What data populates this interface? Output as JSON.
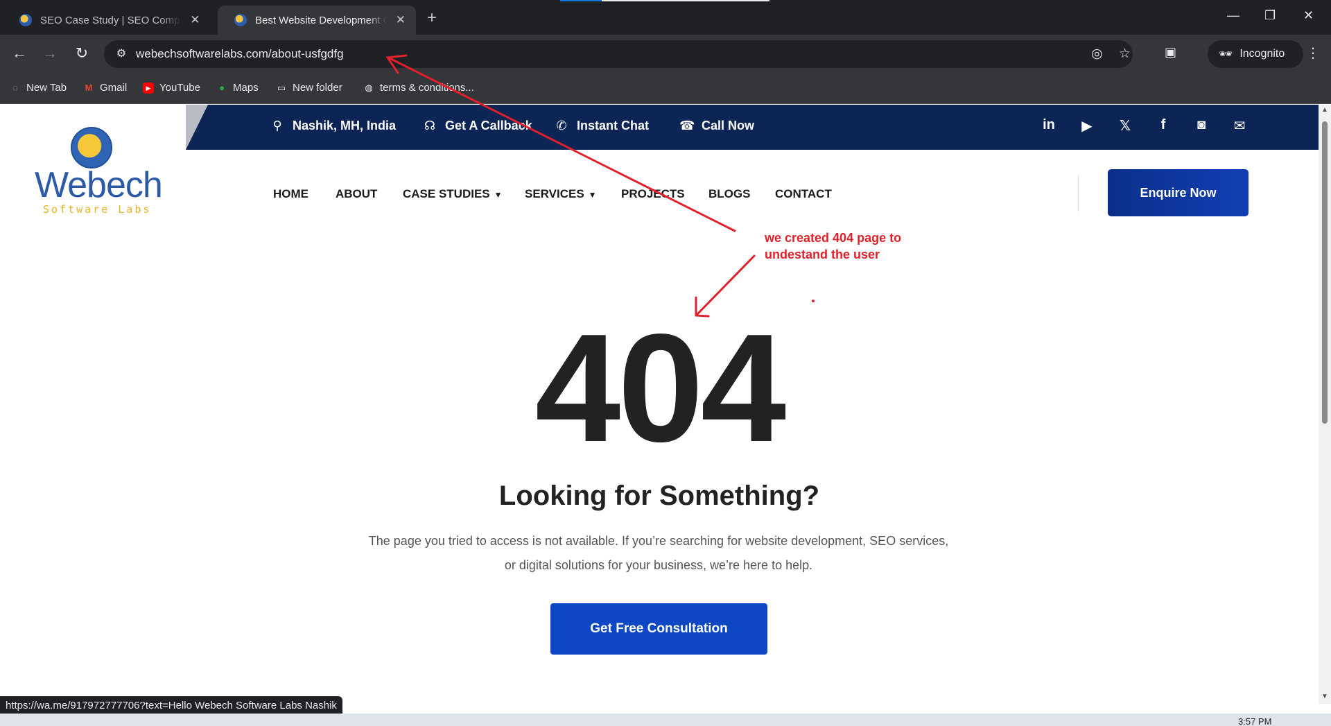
{
  "browser": {
    "tabs": [
      {
        "title": "SEO Case Study | SEO Company",
        "close": "✕",
        "active": false
      },
      {
        "title": "Best Website Development Company",
        "close": "✕",
        "active": true
      }
    ],
    "new_tab": "+",
    "window_controls": {
      "minimize": "—",
      "restore": "❐",
      "close": "✕"
    },
    "url": "webechsoftwarelabs.com/about-usfgdfg",
    "incognito_label": "Incognito",
    "bookmarks": [
      {
        "label": "New Tab",
        "icon": "globe-icon"
      },
      {
        "label": "Gmail",
        "icon": "gmail-icon"
      },
      {
        "label": "YouTube",
        "icon": "youtube-icon"
      },
      {
        "label": "Maps",
        "icon": "maps-icon"
      },
      {
        "label": "New folder",
        "icon": "folder-icon"
      },
      {
        "label": "terms & conditions...",
        "icon": "globe-icon"
      }
    ],
    "status_url": "https://wa.me/917972777706?text=Hello Webech Software Labs Nashik",
    "clock": "3:57 PM"
  },
  "site": {
    "logo": {
      "word": "Webech",
      "sub": "Software Labs"
    },
    "topbar": [
      {
        "label": "Nashik, MH, India",
        "icon": "location-pin-icon"
      },
      {
        "label": "Get A Callback",
        "icon": "headset-icon"
      },
      {
        "label": "Instant Chat",
        "icon": "whatsapp-icon"
      },
      {
        "label": "Call Now",
        "icon": "phone-icon"
      }
    ],
    "social": [
      "linkedin-icon",
      "youtube-icon",
      "x-icon",
      "facebook-icon",
      "instagram-icon",
      "email-icon"
    ],
    "nav": [
      {
        "label": "HOME",
        "dropdown": false
      },
      {
        "label": "ABOUT",
        "dropdown": false
      },
      {
        "label": "CASE STUDIES",
        "dropdown": true
      },
      {
        "label": "SERVICES",
        "dropdown": true
      },
      {
        "label": "PROJECTS",
        "dropdown": false
      },
      {
        "label": "BLOGS",
        "dropdown": false
      },
      {
        "label": "CONTACT",
        "dropdown": false
      }
    ],
    "enquire_label": "Enquire Now",
    "error": {
      "code": "404",
      "heading": "Looking for Something?",
      "description_line1": "The page you tried to access is not available. If you’re searching for website development, SEO services,",
      "description_line2": "or digital solutions for your business, we’re here to help.",
      "cta_label": "Get Free Consultation"
    }
  },
  "annotation": {
    "line1": "we created 404 page to",
    "line2": "undestand the user",
    "color": "#e0202a"
  },
  "colors": {
    "topbar_bg": "#0c2554",
    "enquire_bg": "#123fb4",
    "cta_bg": "#0d47c4",
    "logo_blue": "#2d5aa7",
    "logo_gold": "#e6b21f"
  }
}
